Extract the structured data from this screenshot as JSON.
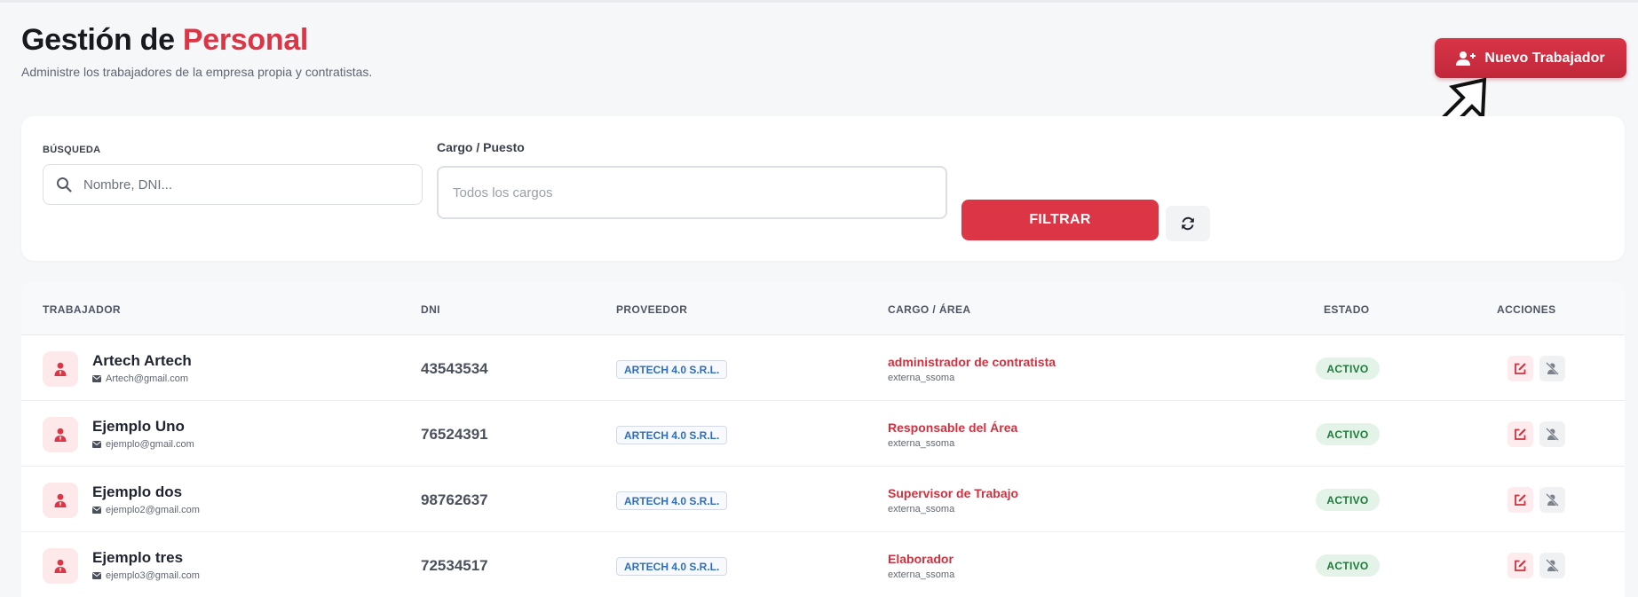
{
  "header": {
    "title_prefix": "Gestión de",
    "title_accent": "Personal",
    "subtitle": "Administre los trabajadores de la empresa propia y contratistas.",
    "new_button_label": "Nuevo Trabajador"
  },
  "filters": {
    "search_label": "BÚSQUEDA",
    "search_placeholder": "Nombre, DNI...",
    "search_value": "",
    "cargo_label": "Cargo / Puesto",
    "cargo_selected": "Todos los cargos",
    "filter_button_label": "FILTRAR"
  },
  "table": {
    "columns": {
      "trabajador": "TRABAJADOR",
      "dni": "DNI",
      "proveedor": "PROVEEDOR",
      "cargo_area": "CARGO / ÁREA",
      "estado": "ESTADO",
      "acciones": "ACCIONES"
    },
    "rows": [
      {
        "name": "Artech Artech",
        "email": "Artech@gmail.com",
        "dni": "43543534",
        "proveedor": "ARTECH 4.0 S.R.L.",
        "cargo": "administrador de contratista",
        "area": "externa_ssoma",
        "estado": "ACTIVO"
      },
      {
        "name": "Ejemplo Uno",
        "email": "ejemplo@gmail.com",
        "dni": "76524391",
        "proveedor": "ARTECH 4.0 S.R.L.",
        "cargo": "Responsable del Área",
        "area": "externa_ssoma",
        "estado": "ACTIVO"
      },
      {
        "name": "Ejemplo dos",
        "email": "ejemplo2@gmail.com",
        "dni": "98762637",
        "proveedor": "ARTECH 4.0 S.R.L.",
        "cargo": "Supervisor de Trabajo",
        "area": "externa_ssoma",
        "estado": "ACTIVO"
      },
      {
        "name": "Ejemplo tres",
        "email": "ejemplo3@gmail.com",
        "dni": "72534517",
        "proveedor": "ARTECH 4.0 S.R.L.",
        "cargo": "Elaborador",
        "area": "externa_ssoma",
        "estado": "ACTIVO"
      }
    ]
  },
  "icons": {
    "new_button": "user-plus-icon",
    "search": "search-icon",
    "refresh": "refresh-icon",
    "avatar": "user-tie-icon",
    "email": "envelope-icon",
    "edit": "edit-icon",
    "deactivate": "user-slash-icon",
    "cursor": "cursor-arrow-icon"
  },
  "colors": {
    "accent": "#dc3545",
    "status_active_bg": "#e4f3e8",
    "status_active_text": "#1e7a3b",
    "provider_text": "#2e6fb8"
  }
}
